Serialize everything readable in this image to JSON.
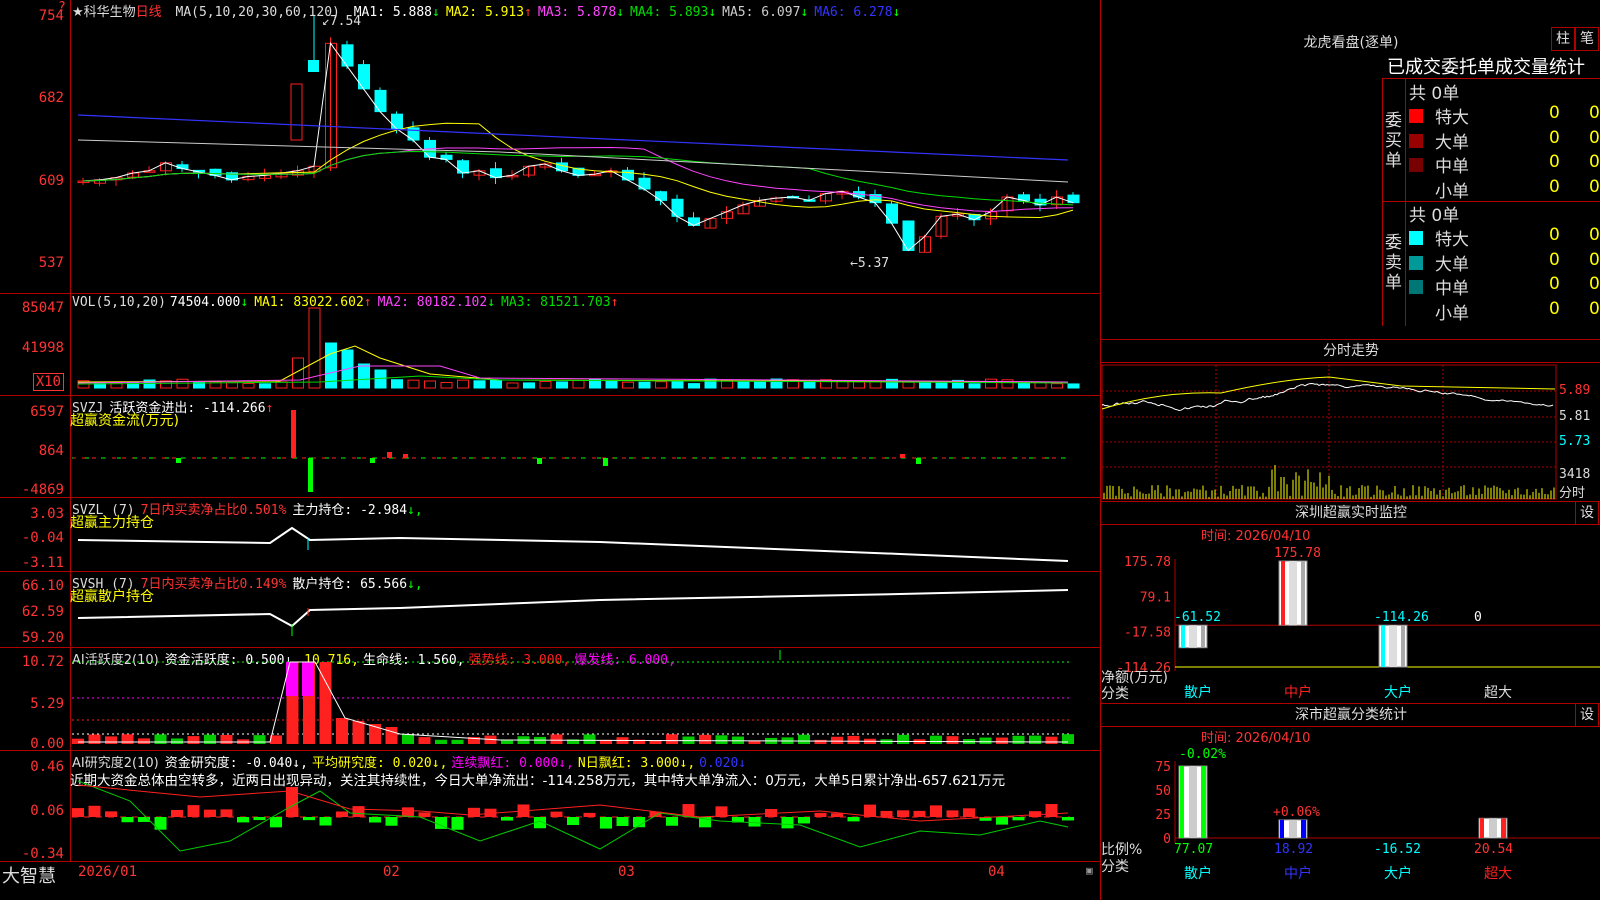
{
  "header": {
    "stock": "★科华生物",
    "period": "日线",
    "ma_label": "MA(5,10,20,30,60,120)",
    "ma": [
      {
        "label": "MA1: 5.888",
        "arrow": "↓",
        "color": "#ffffff"
      },
      {
        "label": "MA2: 5.913",
        "arrow": "↑",
        "color": "#ffff00"
      },
      {
        "label": "MA3: 5.878",
        "arrow": "↓",
        "color": "#ff44ff"
      },
      {
        "label": "MA4: 5.893",
        "arrow": "↓",
        "color": "#00dd00"
      },
      {
        "label": "MA5: 6.097",
        "arrow": "↓",
        "color": "#cccccc"
      },
      {
        "label": "MA6: 6.278",
        "arrow": "↓",
        "color": "#3333ff"
      }
    ],
    "max_label": "7.54",
    "min_label": "5.37",
    "corner_mark": "?"
  },
  "colors": {
    "up": "#ff2020",
    "down": "#00ffff",
    "grid": "#b00000",
    "axis": "#ff3333",
    "yellow": "#ffff00",
    "green": "#00ff00",
    "magenta": "#ff00ff"
  },
  "price_axis": [
    "7.54",
    "6.82",
    "6.09",
    "5.37"
  ],
  "price_axis_disp": [
    "754",
    "682",
    "609",
    "537"
  ],
  "volume": {
    "title": "VOL(5,10,20)",
    "value": "74504.000",
    "value_arrow": "↓",
    "ma": [
      {
        "label": "MA1: 83022.602",
        "arrow": "↑",
        "color": "#ffff00"
      },
      {
        "label": "MA2: 80182.102",
        "arrow": "↓",
        "color": "#ff44ff"
      },
      {
        "label": "MA3: 81521.703",
        "arrow": "↑",
        "color": "#00dd00"
      }
    ],
    "axis": [
      "85047",
      "41998"
    ],
    "unit": "X10"
  },
  "svzj": {
    "title": "SVZJ",
    "desc": "活跃资金进出: -114.266",
    "arrow": "↑",
    "sub": "超赢资金流(万元)",
    "axis": [
      "6597",
      "864",
      "-4869"
    ]
  },
  "svzl": {
    "title": "SVZL (7)",
    "desc1": "7日内买卖净占比0.501%",
    "desc2": "主力持仓: -2.984",
    "arrow": "↓,",
    "sub": "超赢主力持仓",
    "axis": [
      "3.03",
      "-0.04",
      "-3.11"
    ]
  },
  "svsh": {
    "title": "SVSH (7)",
    "desc1": "7日内买卖净占比0.149%",
    "desc2": "散户持仓: 65.566",
    "arrow": "↓,",
    "sub": "超赢散户持仓",
    "axis": [
      "66.10",
      "62.59",
      "59.20"
    ]
  },
  "ai_active": {
    "title": "AI活跃度2(10)",
    "items": [
      {
        "label": "资金活跃度: 0.500↓,",
        "color": "#ffffff"
      },
      {
        "label": "10.716,",
        "color": "#ffff00"
      },
      {
        "label": "生命线: 1.560,",
        "color": "#ffffff"
      },
      {
        "label": "强势线: 3.000,",
        "color": "#ff2020"
      },
      {
        "label": "爆发线: 6.000,",
        "color": "#ff00ff"
      }
    ],
    "axis": [
      "10.72",
      "5.29",
      "0.00"
    ]
  },
  "ai_research": {
    "title": "AI研究度2(10)",
    "items": [
      {
        "label": "资金研究度: -0.040↓,",
        "color": "#ffffff"
      },
      {
        "label": "平均研究度: 0.020↓,",
        "color": "#ffff00"
      },
      {
        "label": "连续飘红: 0.000↓,",
        "color": "#ff00ff"
      },
      {
        "label": "N日飘红: 3.000↓,",
        "color": "#ffff00"
      },
      {
        "label": "0.020↓",
        "color": "#3333ff"
      }
    ],
    "text": "近期大资金总体由空转多，近两日出现异动，关注其持续性，今日大单净流出：-114.258万元，其中特大单净流入：0万元，大单5日累计净出-657.621万元",
    "axis": [
      "0.46",
      "0.06",
      "-0.34"
    ]
  },
  "date_axis": {
    "brand": "大智慧",
    "labels": [
      "2026/01",
      "02",
      "03",
      "04"
    ]
  },
  "dragon": {
    "title": "龙虎看盘(逐单)",
    "btn1": "柱",
    "btn2": "笔",
    "sub": "已成交委托单成交量统计",
    "buy": {
      "label": "委买单",
      "total": "共 0单",
      "rows": [
        {
          "name": "特大",
          "count": "0",
          "pct": "0%",
          "color": "#ff0000"
        },
        {
          "name": "大单",
          "count": "0",
          "pct": "0%",
          "color": "#990000"
        },
        {
          "name": "中单",
          "count": "0",
          "pct": "0%",
          "color": "#770000"
        },
        {
          "name": "小单",
          "count": "0",
          "pct": "0%",
          "color": "#000000"
        }
      ]
    },
    "sell": {
      "label": "委卖单",
      "total": "共 0单",
      "rows": [
        {
          "name": "特大",
          "count": "0",
          "pct": "0%",
          "color": "#00ffff"
        },
        {
          "name": "大单",
          "count": "0",
          "pct": "0%",
          "color": "#009999"
        },
        {
          "name": "中单",
          "count": "0",
          "pct": "0%",
          "color": "#007777"
        },
        {
          "name": "小单",
          "count": "0",
          "pct": "0%",
          "color": "#000000"
        }
      ]
    }
  },
  "intraday": {
    "title": "分时走势",
    "axis": [
      "5.89",
      "5.81",
      "5.73"
    ],
    "vol_axis": "3418",
    "vol_label": "分时"
  },
  "sz_monitor": {
    "title": "深圳超赢实时监控",
    "btn": "设",
    "time": "时间: 2026/04/10",
    "axis": [
      "175.78",
      "79.1",
      "-17.58",
      "-114.26"
    ],
    "ylabel": "净额(万元)",
    "xlabel": "分类",
    "categories": [
      "散户",
      "中户",
      "大户",
      "超大"
    ],
    "values": [
      "-61.52",
      "175.78",
      "-114.26",
      "0"
    ]
  },
  "sz_class": {
    "title": "深市超赢分类统计",
    "btn": "设",
    "time": "时间: 2026/04/10",
    "axis": [
      "75",
      "50",
      "25",
      "0"
    ],
    "ylabel": "比例%",
    "xlabel": "分类",
    "top": [
      "-0.02%",
      "+0.06%"
    ],
    "categories": [
      "散户",
      "中户",
      "大户",
      "超大"
    ],
    "values": [
      "77.07",
      "18.92",
      "-16.52",
      "20.54"
    ]
  },
  "chart_data": [
    {
      "type": "bar",
      "title": "深圳超赢实时监控",
      "ylabel": "净额(万元)",
      "xlabel": "分类",
      "categories": [
        "散户",
        "中户",
        "大户",
        "超大"
      ],
      "values": [
        -61.52,
        175.78,
        -114.26,
        0
      ],
      "ylim": [
        -114.26,
        175.78
      ]
    },
    {
      "type": "bar",
      "title": "深市超赢分类统计",
      "ylabel": "比例%",
      "xlabel": "分类",
      "categories": [
        "散户",
        "中户",
        "大户",
        "超大"
      ],
      "values": [
        77.07,
        18.92,
        -16.52,
        20.54
      ],
      "ylim": [
        0,
        75
      ]
    }
  ]
}
